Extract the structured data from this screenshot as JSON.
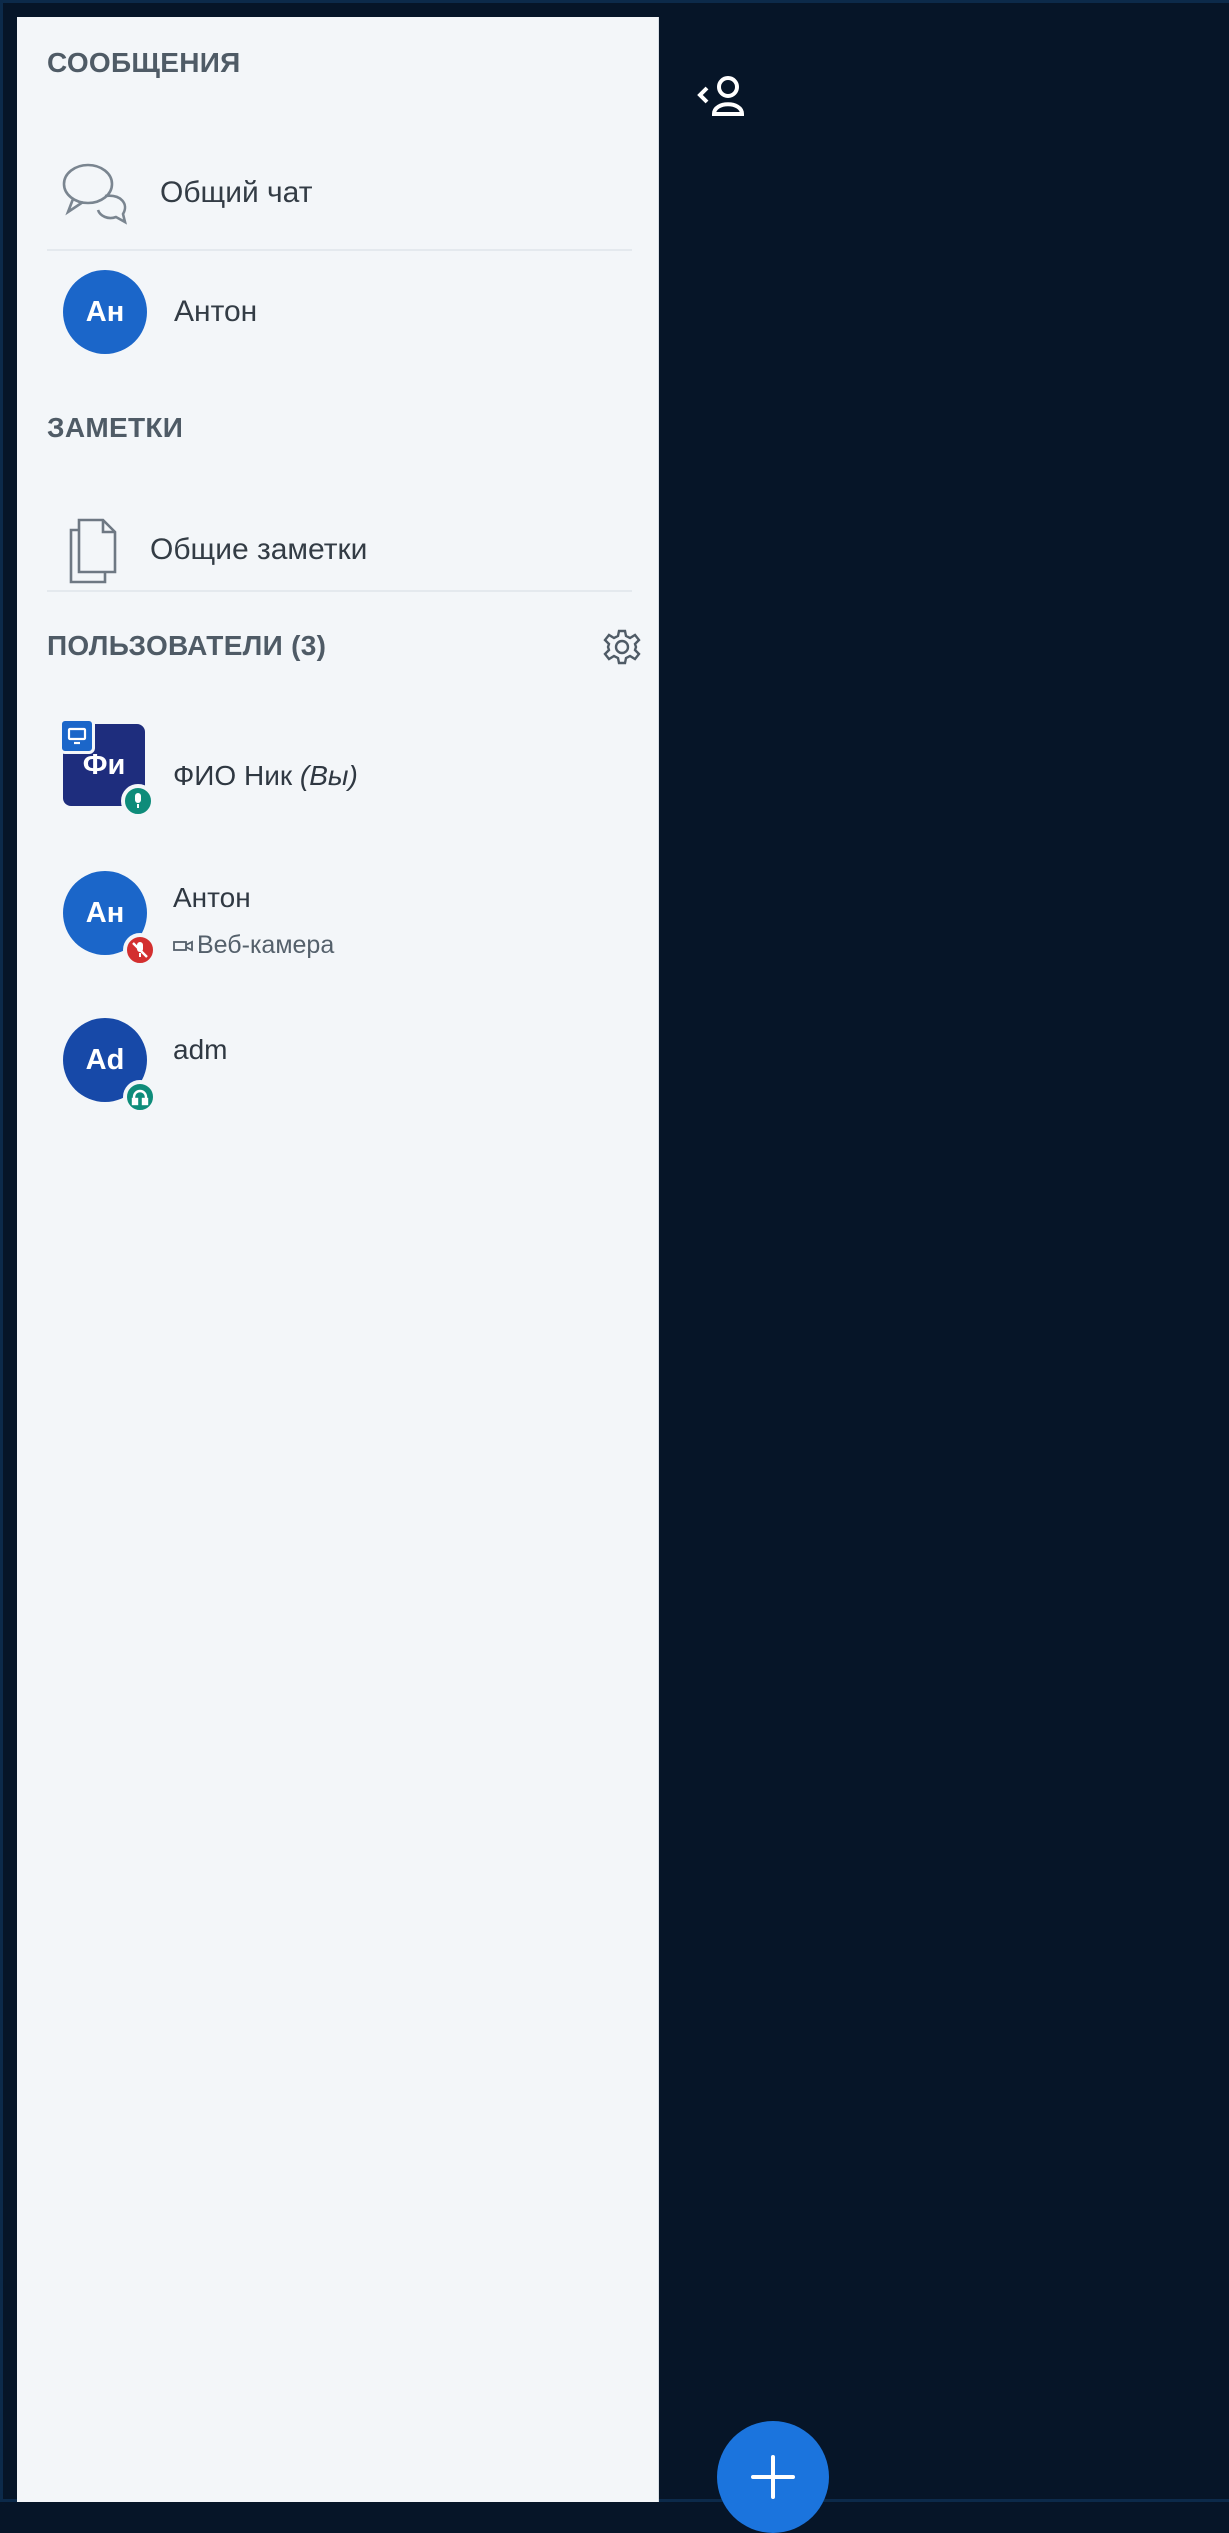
{
  "sidebar": {
    "messages": {
      "title": "СООБЩЕНИЯ",
      "items": [
        {
          "label": "Общий чат",
          "icon": "chat-bubbles-icon"
        },
        {
          "label": "Антон",
          "avatar_initials": "Ан"
        }
      ]
    },
    "notes": {
      "title": "ЗАМЕТКИ",
      "items": [
        {
          "label": "Общие заметки",
          "icon": "notes-icon"
        }
      ]
    },
    "users": {
      "title": "ПОЛЬЗОВАТЕЛИ (3)",
      "settings_icon": "gear-icon",
      "list": [
        {
          "initials": "Фи",
          "name": "ФИО Ник",
          "you_label": "(Вы)",
          "presenter": true,
          "status": "microphone-active",
          "status_color": "#0e8c7a"
        },
        {
          "initials": "Ан",
          "name": "Антон",
          "status": "microphone-muted",
          "status_color": "#d32f2f",
          "sub": "Веб-камера"
        },
        {
          "initials": "Ad",
          "name": "adm",
          "status": "listen-only",
          "status_color": "#0e8c7a"
        }
      ]
    }
  },
  "main": {
    "toggle_icon": "collapse-users-icon",
    "fab_icon": "plus-icon"
  },
  "colors": {
    "sidebar_bg": "#f3f6f9",
    "main_bg": "#061528",
    "accent": "#1b66c9"
  }
}
